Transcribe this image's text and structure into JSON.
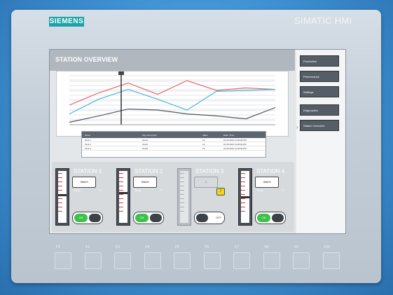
{
  "panel": {
    "brand": "SIEMENS",
    "product": "SIMATIC HMI"
  },
  "screen": {
    "title": "STATION OVERVIEW",
    "chart_data": {
      "type": "line",
      "title": "",
      "xlabel": "",
      "ylabel": "",
      "grid": true,
      "ylim": [
        0,
        100
      ],
      "x": [
        0,
        1,
        2,
        3,
        4,
        5,
        6,
        7
      ],
      "series": [
        {
          "color": "#e06a6a",
          "values": [
            40,
            65,
            85,
            62,
            90,
            70,
            75,
            72
          ]
        },
        {
          "color": "#49b4de",
          "values": [
            22,
            52,
            72,
            52,
            30,
            68,
            70,
            72
          ]
        },
        {
          "color": "#505760",
          "values": [
            5,
            18,
            32,
            30,
            22,
            18,
            12,
            35
          ]
        }
      ]
    },
    "table": {
      "columns": [
        "Name",
        "Tag Connection",
        "Value",
        "Date / Time"
      ],
      "rows": [
        {
          "name": "Tank 1",
          "tag": "Tank1",
          "value": "12",
          "date": "01.06.2012 11:00:00 PM"
        },
        {
          "name": "Tank 2",
          "tag": "Tank2",
          "value": "14",
          "date": "01.06.2012 11:00:00 PM"
        },
        {
          "name": "Tank 3",
          "tag": "Tank3",
          "value": "16",
          "date": "01.06.2012 11:00:00 PM"
        }
      ]
    },
    "menu": [
      "Production",
      "Performance",
      "Settings",
      "Diagnostics",
      "Station Overview"
    ],
    "stations": [
      {
        "name": "STATION 1",
        "value": "35629",
        "label": "Temp",
        "unit": "°C",
        "state": "ON",
        "active": true,
        "level": 0.55
      },
      {
        "name": "STATION 2",
        "value": "35629",
        "label": "Temp",
        "unit": "°C",
        "state": "ON",
        "active": true,
        "level": 0.6
      },
      {
        "name": "STATION 3",
        "value": "0",
        "label": "",
        "unit": "",
        "state": "OFF",
        "active": false,
        "level": 0.0,
        "warning": "!"
      },
      {
        "name": "STATION 4",
        "value": "35629",
        "label": "Temp",
        "unit": "°C",
        "state": "ON",
        "active": true,
        "level": 0.52
      }
    ]
  },
  "fkeys": [
    "F1",
    "F2",
    "F3",
    "F4",
    "F5",
    "F6",
    "F7",
    "F8",
    "F9",
    "F10"
  ]
}
